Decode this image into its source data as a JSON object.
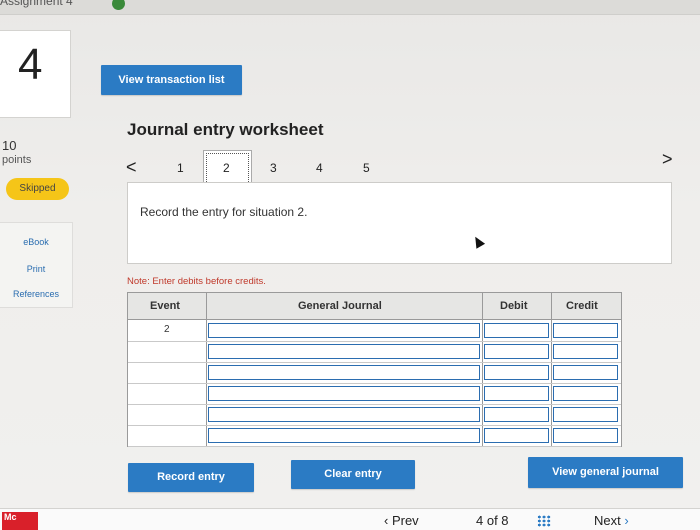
{
  "topbar": {
    "breadcrumb": "Assignment 4"
  },
  "question": {
    "number": "4",
    "points_value": "10",
    "points_label": "points",
    "status": "Skipped"
  },
  "buttons": {
    "view_transaction_list": "View transaction list",
    "record_entry": "Record entry",
    "clear_entry": "Clear entry",
    "view_general_journal": "View general journal"
  },
  "sidebar": {
    "links": [
      "eBook",
      "Print",
      "References"
    ]
  },
  "worksheet": {
    "title": "Journal entry worksheet",
    "pager": {
      "prev": "<",
      "next": ">",
      "pages": [
        "1",
        "2",
        "3",
        "4",
        "5"
      ],
      "active": "2"
    },
    "instruction": "Record the entry for situation 2.",
    "note": "Note: Enter debits before credits."
  },
  "journal_table": {
    "headers": [
      "Event",
      "General Journal",
      "Debit",
      "Credit"
    ],
    "rows": [
      {
        "event": "2",
        "account": "",
        "debit": "",
        "credit": ""
      },
      {
        "event": "",
        "account": "",
        "debit": "",
        "credit": ""
      },
      {
        "event": "",
        "account": "",
        "debit": "",
        "credit": ""
      },
      {
        "event": "",
        "account": "",
        "debit": "",
        "credit": ""
      },
      {
        "event": "",
        "account": "",
        "debit": "",
        "credit": ""
      },
      {
        "event": "",
        "account": "",
        "debit": "",
        "credit": ""
      }
    ]
  },
  "bottom_nav": {
    "logo": "Mc",
    "prev": "Prev",
    "position": "4 of 8",
    "next": "Next"
  },
  "colors": {
    "accent": "#2b7bc4",
    "skipped_badge": "#f5c518",
    "note_text": "#c0392b",
    "logo_red": "#d9202a"
  }
}
